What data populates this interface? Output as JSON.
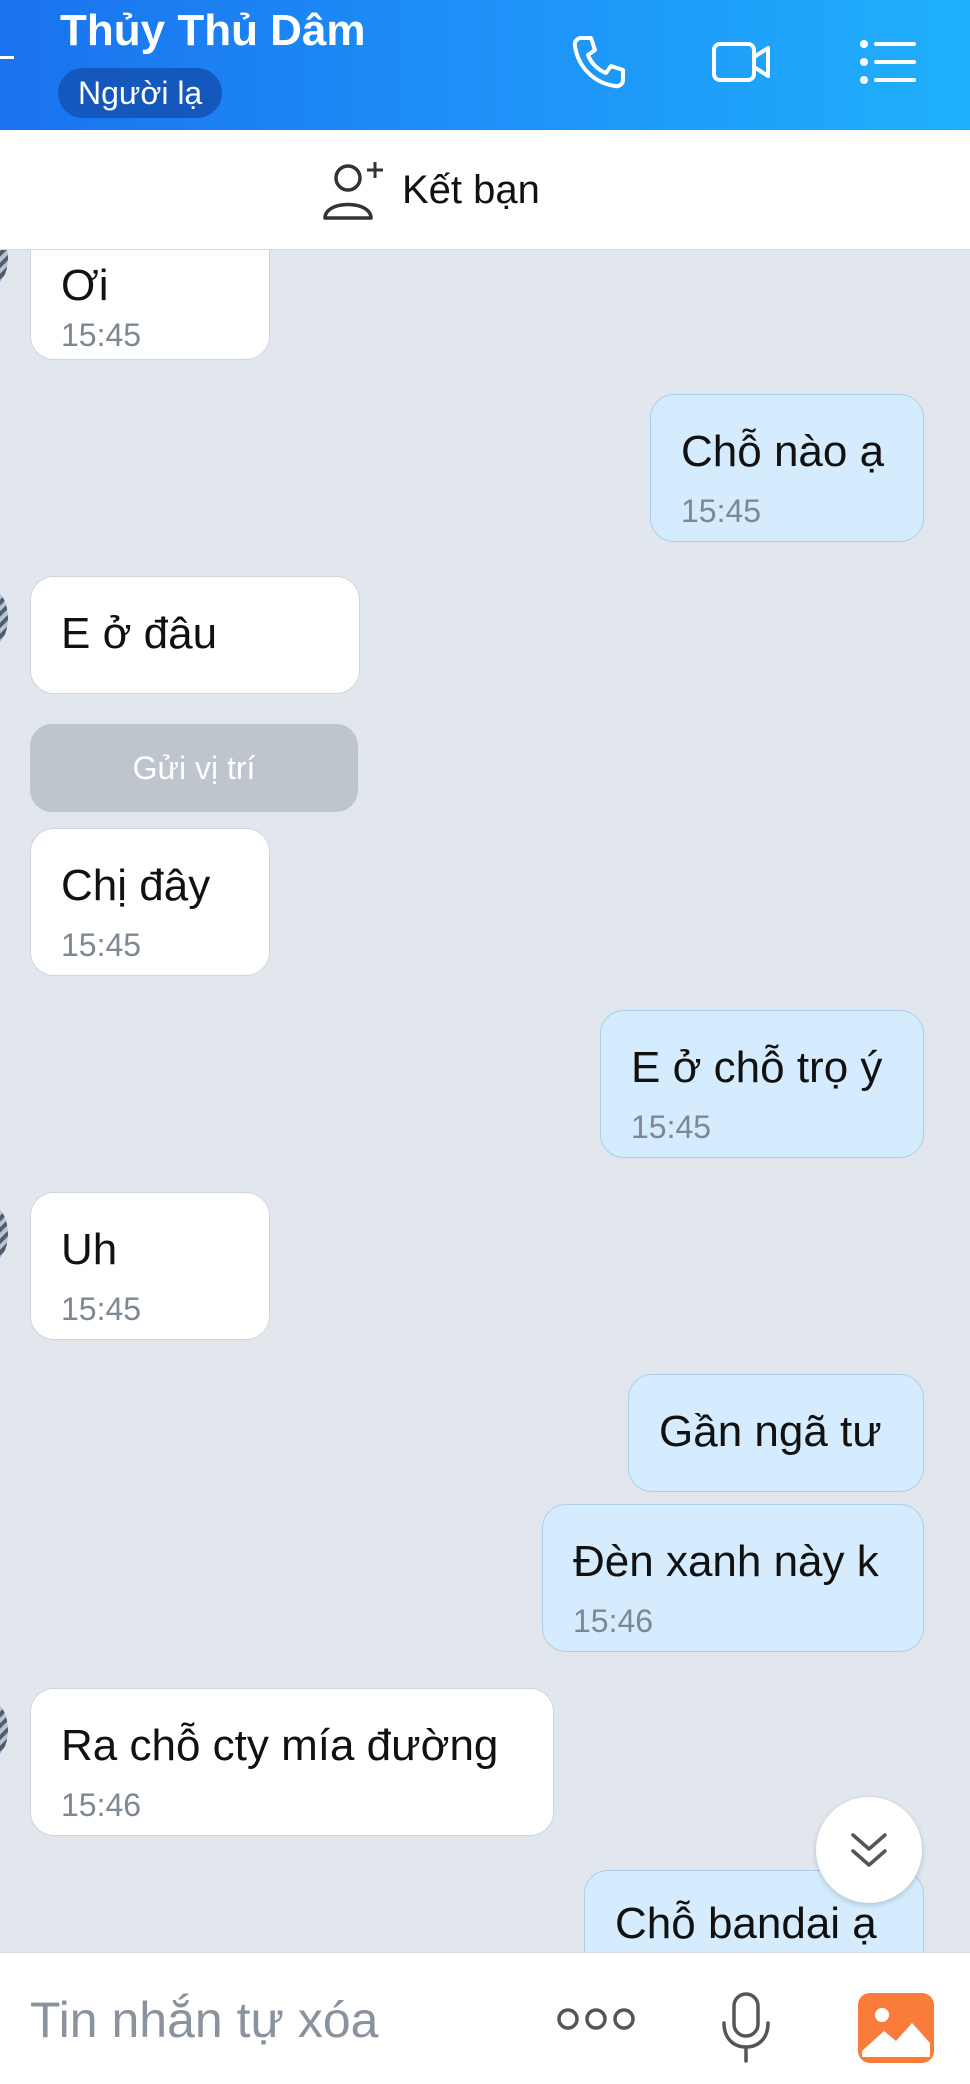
{
  "header": {
    "title": "Thủy Thủ Dâm",
    "badge": "Người lạ",
    "icons": [
      "phone-icon",
      "video-call-icon",
      "menu-list-icon"
    ]
  },
  "friend_bar": {
    "label": "Kết bạn",
    "icon": "add-friend-icon"
  },
  "messages": [
    {
      "side": "in",
      "text": "Ơi",
      "time": "15:45"
    },
    {
      "side": "out",
      "text": "Chỗ nào ạ",
      "time": "15:45"
    },
    {
      "side": "in",
      "text": "E ở đâu",
      "time": ""
    },
    {
      "side": "in",
      "type": "action",
      "text": "Gửi vị trí"
    },
    {
      "side": "in",
      "text": "Chị đây",
      "time": "15:45"
    },
    {
      "side": "out",
      "text": "E ở chỗ trọ ý",
      "time": "15:45"
    },
    {
      "side": "in",
      "text": "Uh",
      "time": "15:45"
    },
    {
      "side": "out",
      "text": "Gần ngã tư",
      "time": ""
    },
    {
      "side": "out",
      "text": "Đèn xanh này k",
      "time": "15:46"
    },
    {
      "side": "in",
      "text": "Ra chỗ cty mía đường",
      "time": "15:46"
    },
    {
      "side": "out",
      "text": "Chỗ bandai ạ",
      "time": ""
    }
  ],
  "scroll_down_icon": "double-chevron-down-icon",
  "input": {
    "placeholder": "Tin nhắn tự xóa",
    "icons": [
      "more-options-icon",
      "microphone-icon",
      "gallery-icon"
    ]
  },
  "colors": {
    "header_gradient_start": "#1a72ee",
    "header_gradient_end": "#1fb0fb",
    "outgoing_bubble": "#d4ecfd",
    "incoming_bubble": "#ffffff",
    "chat_background": "#e2e7ee",
    "gallery_icon": "#f97c3b"
  }
}
